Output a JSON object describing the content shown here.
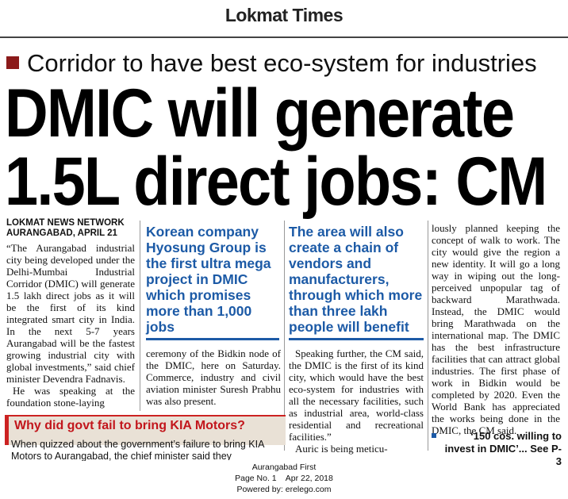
{
  "masthead": {
    "title": "Lokmat Times"
  },
  "article": {
    "kicker": "Corridor to have best eco-system for industries",
    "headline_line1": "DMIC will generate",
    "headline_line2": "1.5L direct jobs: CM",
    "byline_network": "LOKMAT NEWS NETWORK",
    "byline_dateline": "AURANGABAD, APRIL 21",
    "col1_p1": "“The Aurangabad industrial city being developed under the Delhi-Mumbai Industrial Corridor (DMIC) will generate 1.5 lakh direct jobs as it will be the first of its kind integrated smart city in India. In the next 5-7 years Aurangabad will be the fastest growing industrial city with global investments,” said chief minister Devendra Fadnavis.",
    "col1_p2": "He was speaking at the foundation stone-laying",
    "pull_quote_1": "Korean company Hyosung Group is the first ultra mega project in DMIC which promises more than 1,000 jobs",
    "col2_text": "ceremony of the Bidkin node of the DMIC, here on Saturday. Commerce, industry and civil aviation minister Suresh Prabhu was also present.",
    "pull_quote_2": "The area will also create a chain of vendors and manufacturers, through which more than three lakh people will benefit",
    "col3_p1": "Speaking further, the CM said, the DMIC is the first of its kind city, which would have the best eco-system for industries with all the necessary facilities, such as industrial area, world-class residential and recreational facilities.”",
    "col3_p2": "Auric is being meticu-",
    "col4_text": "lously planned keeping the concept of walk to work. The city would give the region a new identity. It will go a long way in wiping out the long-perceived unpopular tag of backward Marathwada. Instead, the DMIC would bring Marathwada on the international map. The DMIC has the best infrastructure facilities that can attract global industries. The first phase of work in Bidkin would be completed by 2020. Even the World Bank has appreciated the works being done in the DMIC, the CM said.",
    "teaser": "‘150 cos. willing to invest in DMIC’... See P-3"
  },
  "sidebar": {
    "title": "Why did govt fail to bring KIA Motors?",
    "text": "When quizzed about the government’s failure to bring KIA Motors to Aurangabad, the chief minister said they"
  },
  "footer": {
    "edition": "Aurangabad First",
    "page_info": "Page No. 1    Apr 22, 2018",
    "powered_by": "Powered by: erelego.com"
  },
  "colors": {
    "accent_red": "#8b1a1a",
    "pull_blue": "#1c5aa6",
    "kia_red": "#c2161c"
  }
}
